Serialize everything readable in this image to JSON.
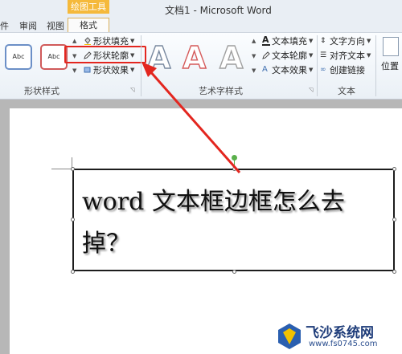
{
  "window": {
    "title": "文档1 - Microsoft Word",
    "contextual_tab": "绘图工具"
  },
  "tabs": [
    "件",
    "审阅",
    "视图",
    "格式"
  ],
  "ribbon": {
    "shape_style_previews": [
      "Abc",
      "Abc"
    ],
    "shape_commands": [
      {
        "label": "形状填充",
        "icon": "paint-bucket-icon"
      },
      {
        "label": "形状轮廓",
        "icon": "pencil-outline-icon"
      },
      {
        "label": "形状效果",
        "icon": "shape-effects-icon"
      }
    ],
    "text_commands": [
      {
        "label": "文本填充",
        "icon": "text-fill-icon"
      },
      {
        "label": "文本轮廓",
        "icon": "text-outline-icon"
      },
      {
        "label": "文本效果",
        "icon": "text-effects-icon"
      }
    ],
    "text_group_commands": [
      {
        "label": "文字方向",
        "icon": "text-direction-icon"
      },
      {
        "label": "对齐文本",
        "icon": "align-text-icon"
      },
      {
        "label": "创建链接",
        "icon": "create-link-icon"
      }
    ],
    "position_label": "位置",
    "groups": {
      "shape_styles": "形状样式",
      "wordart_styles": "艺术字样式",
      "text": "文本"
    }
  },
  "document": {
    "textbox_text": "word 文本框边框怎么去掉？"
  },
  "watermark": {
    "title": "飞沙系统网",
    "url": "www.fs0745.com"
  },
  "colors": {
    "highlight": "#e3261f",
    "contextual_tab": "#f5b93b",
    "handle_rotate": "#5ab04b"
  }
}
